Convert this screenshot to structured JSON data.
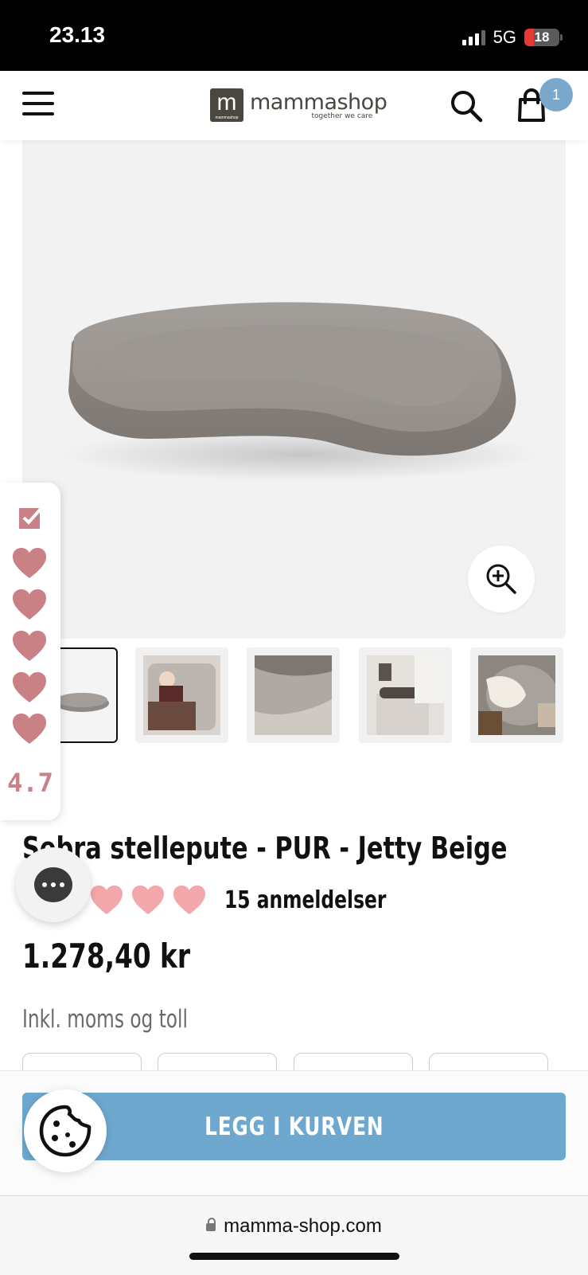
{
  "status_bar": {
    "time": "23.13",
    "network": "5G",
    "battery": "18"
  },
  "header": {
    "logo_name": "mammashop",
    "logo_mark": "m",
    "logo_mark_small": "mammashop",
    "logo_tagline": "together we care",
    "cart_count": "1",
    "icons": [
      "menu-icon",
      "search-icon",
      "shopping-bag-icon"
    ]
  },
  "product": {
    "brand": "ra",
    "title": "Sebra stellepute - PUR - Jetty Beige",
    "rating_hearts": 5,
    "review_count": "15 anmeldelser",
    "price": "1.278,40 kr",
    "tax_note": "Inkl. moms og toll",
    "thumbnails": [
      "changing-pad",
      "baby-on-pad",
      "pad-closeup",
      "pad-on-dresser",
      "pad-with-blanket"
    ]
  },
  "rating_widget": {
    "score": "4.7",
    "hearts": 5
  },
  "cart_bar": {
    "add_button": "LEGG I KURVEN"
  },
  "browser": {
    "url": "mamma-shop.com"
  },
  "colors": {
    "accent_blue": "#6ea8cf",
    "heart_pink": "#f2a7ab",
    "widget_pink": "#c98185",
    "badge_blue": "#7aa8cc"
  }
}
